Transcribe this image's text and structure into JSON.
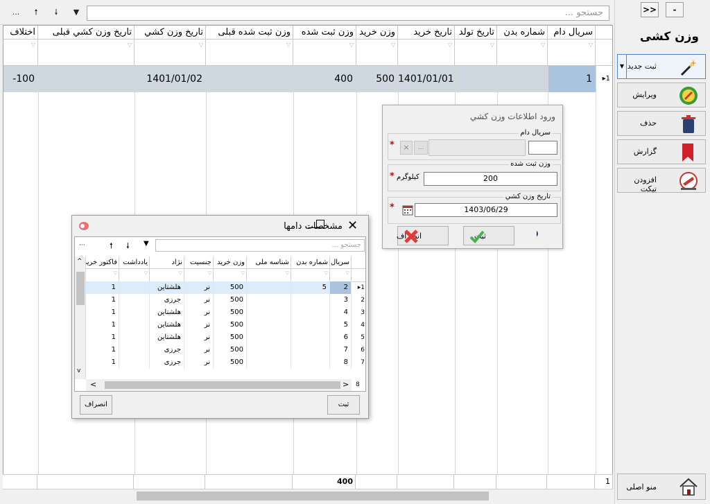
{
  "toolbar": {
    "more": "...",
    "sort_up": "🠕",
    "sort_down": "🠗",
    "filter": "▼",
    "search_placeholder": "جستجو ..."
  },
  "grid": {
    "columns": [
      "سريال دام",
      "شماره بدن",
      "تاريخ تولد",
      "تاريخ خريد",
      "وزن خريد",
      "وزن ثبت شده",
      "وزن ثبت شده قبلی",
      "تاريخ وزن کشي",
      "تاريخ وزن کشي قبلی",
      "اختلاف"
    ],
    "row": {
      "row_number": "1",
      "serial": "1",
      "body_number": "",
      "birth_date": "",
      "purchase_date": "1401/01/01",
      "purchase_weight": "500",
      "recorded_weight": "400",
      "prev_recorded_weight": "",
      "weigh_date": "1401/01/02",
      "prev_weigh_date": "",
      "difference": "-100"
    },
    "footer": {
      "count": "1",
      "weight_total": "400"
    }
  },
  "panel": {
    "collapse_label": "-",
    "expand_label": ">>",
    "title": "وزن کشی",
    "actions": [
      {
        "label": "ثبت جدید",
        "icon": "magic-wand-icon"
      },
      {
        "label": "ويرايش",
        "icon": "edit-pencil-icon"
      },
      {
        "label": "حذف",
        "icon": "trash-can-icon"
      },
      {
        "label": "گزارش",
        "icon": "report-bookmark-icon"
      },
      {
        "label": "افزودن تيکت",
        "icon": "add-ticket-icon"
      }
    ],
    "home": {
      "label": "منو اصلی",
      "icon": "home-icon"
    }
  },
  "weight_dialog": {
    "title": "ورود اطلاعات وزن کشي",
    "serial_label": "سريال دام",
    "serial_value": "",
    "weight_label": "وزن ثبت شده",
    "weight_value": "200",
    "weight_unit": "کيلوگرم",
    "date_label": "تاريخ وزن کشي",
    "date_value": "1403/06/29",
    "required": "*",
    "save_label": "ثبت",
    "cancel_label": "انصراف",
    "browse_label": "...",
    "clear_label": "×"
  },
  "cow_dialog": {
    "title": "مشخصات دامها",
    "search_placeholder": "جستجو ...",
    "columns": [
      "سريال",
      "شماره بدن",
      "شناسه ملی",
      "وزن خريد",
      "جنسيت",
      "نژاد",
      "يادداشت",
      "فاکتور خريد"
    ],
    "rows": [
      {
        "n": "1",
        "serial": "2",
        "body": "5",
        "national": "",
        "weight": "500",
        "sex": "نر",
        "breed": "هلشتاين",
        "note": "",
        "invoice": "1"
      },
      {
        "n": "2",
        "serial": "3",
        "body": "",
        "national": "",
        "weight": "500",
        "sex": "نر",
        "breed": "جرزی",
        "note": "",
        "invoice": "1"
      },
      {
        "n": "3",
        "serial": "4",
        "body": "",
        "national": "",
        "weight": "500",
        "sex": "نر",
        "breed": "هلشتاين",
        "note": "",
        "invoice": "1"
      },
      {
        "n": "4",
        "serial": "5",
        "body": "",
        "national": "",
        "weight": "500",
        "sex": "نر",
        "breed": "هلشتاين",
        "note": "",
        "invoice": "1"
      },
      {
        "n": "5",
        "serial": "6",
        "body": "",
        "national": "",
        "weight": "500",
        "sex": "نر",
        "breed": "هلشتاين",
        "note": "",
        "invoice": "1"
      },
      {
        "n": "6",
        "serial": "7",
        "body": "",
        "national": "",
        "weight": "500",
        "sex": "نر",
        "breed": "جرزی",
        "note": "",
        "invoice": "1"
      },
      {
        "n": "7",
        "serial": "8",
        "body": "",
        "national": "",
        "weight": "500",
        "sex": "نر",
        "breed": "جرزی",
        "note": "",
        "invoice": "1"
      }
    ],
    "footer_count": "8",
    "save_label": "ثبت",
    "cancel_label": "انصراف"
  },
  "colors": {
    "selected_row": "#cfd7e0",
    "serial_highlight": "#a9c4dc",
    "accent": "#4c8ac6",
    "required": "#d90000"
  }
}
